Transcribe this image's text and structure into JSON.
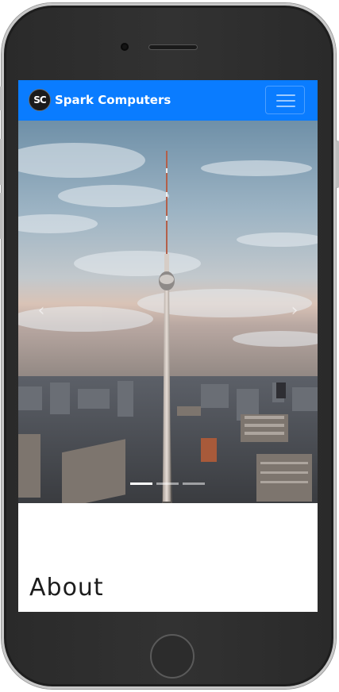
{
  "navbar": {
    "brand_name": "Spark Computers",
    "logo_initials": "SC",
    "background_color": "#0a7cff",
    "toggler_icon": "hamburger-menu-icon"
  },
  "carousel": {
    "slide_image": "tv-tower-city-skyline-photo",
    "prev_icon": "chevron-left-icon",
    "next_icon": "chevron-right-icon",
    "prev_glyph": "‹",
    "next_glyph": "›",
    "indicators": [
      {
        "active": true
      },
      {
        "active": false
      },
      {
        "active": false
      }
    ]
  },
  "about": {
    "heading": "About"
  }
}
